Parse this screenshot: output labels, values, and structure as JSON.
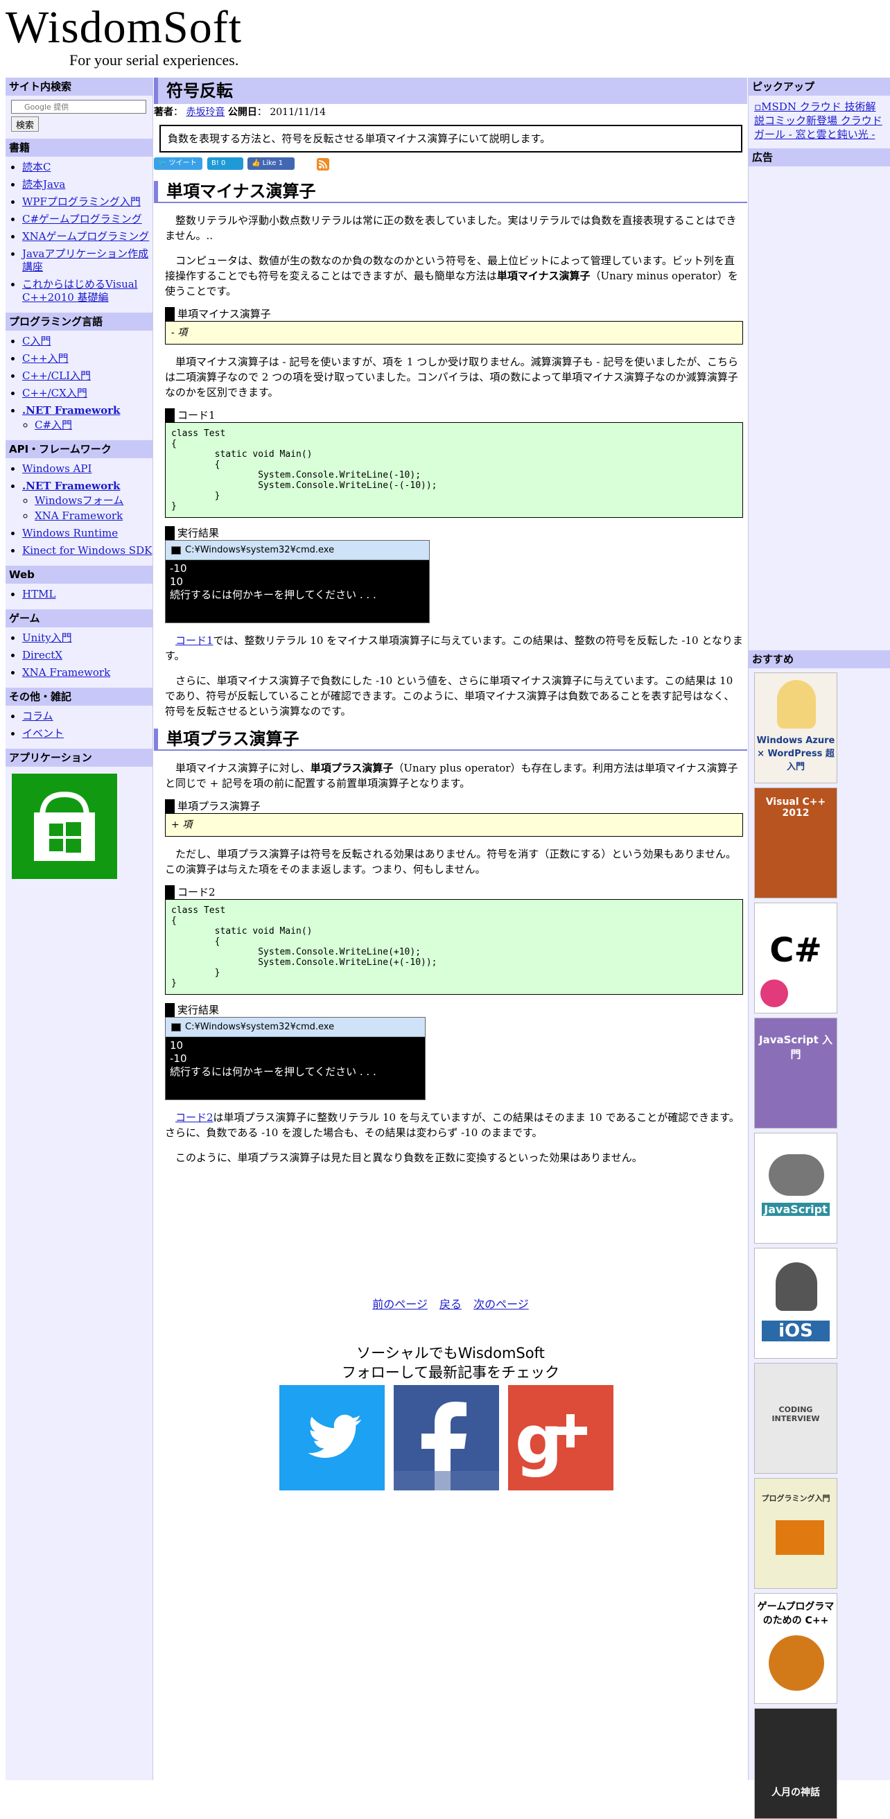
{
  "header": {
    "site_name": "WisdomSoft",
    "tagline": "For your serial experiences."
  },
  "left": {
    "search": {
      "heading": "サイト内検索",
      "placeholder": "Google 提供",
      "button": "検索"
    },
    "books": {
      "heading": "書籍",
      "items": [
        "読本C",
        "読本Java",
        "WPFプログラミング入門",
        "C#ゲームプログラミング",
        "XNAゲームプログラミング",
        "Javaアプリケーション作成講座",
        "これからはじめるVisual C++2010 基礎編"
      ]
    },
    "languages": {
      "heading": "プログラミング言語",
      "items": [
        "C入門",
        "C++入門",
        "C++/CLI入門",
        "C++/CX入門",
        ".NET Framework"
      ],
      "sub_items": [
        "C#入門"
      ]
    },
    "api": {
      "heading": "API・フレームワーク",
      "items": [
        "Windows API",
        ".NET Framework"
      ],
      "sub_items": [
        "Windowsフォーム",
        "XNA Framework"
      ],
      "items_after": [
        "Windows Runtime",
        "Kinect for Windows SDK"
      ]
    },
    "web": {
      "heading": "Web",
      "items": [
        "HTML"
      ]
    },
    "game": {
      "heading": "ゲーム",
      "items": [
        "Unity入門",
        "DirectX",
        "XNA Framework"
      ]
    },
    "misc": {
      "heading": "その他・雑記",
      "items": [
        "コラム",
        "イベント"
      ]
    },
    "apps": {
      "heading": "アプリケーション"
    }
  },
  "article": {
    "title": "符号反転",
    "author_label": "著者",
    "author": "赤坂玲音",
    "date_label": "公開日",
    "date": "2011/11/14",
    "summary": "負数を表現する方法と、符号を反転させる単項マイナス演算子にいて説明します。",
    "share": {
      "tweet": "ツイート",
      "hatena": "B! 0",
      "like": "Like 1"
    },
    "sec1": {
      "heading": "単項マイナス演算子",
      "p1": "整数リテラルや浮動小数点数リテラルは常に正の数を表していました。実はリテラルでは負数を直接表現することはできません。..",
      "p2_a": "コンピュータは、数値が生の数なのか負の数なのかという符号を、最上位ビットによって管理しています。ビット列を直接操作することでも符号を変えることはできますが、最も簡単な方法は",
      "p2_b": "単項マイナス演算子",
      "p2_c": "（Unary minus operator）を使うことです。",
      "syntax_label": "単項マイナス演算子",
      "syntax": "- 項",
      "p3": "単項マイナス演算子は - 記号を使いますが、項を 1 つしか受け取りません。減算演算子も - 記号を使いましたが、こちらは二項演算子なので 2 つの項を受け取っていました。コンパイラは、項の数によって単項マイナス演算子なのか減算演算子なのかを区別できます。",
      "code_label": "コード1",
      "code": "class Test\n{\n        static void Main()\n        {\n                System.Console.WriteLine(-10);\n                System.Console.WriteLine(-(-10));\n        }\n}",
      "result_label": "実行結果",
      "console_title": "C:¥Windows¥system32¥cmd.exe",
      "console_output": "-10\n10\n続行するには何かキーを押してください . . .",
      "p4_link": "コード1",
      "p4": "では、整数リテラル 10 をマイナス単項演算子に与えています。この結果は、整数の符号を反転した -10 となります。",
      "p5": "さらに、単項マイナス演算子で負数にした -10 という値を、さらに単項マイナス演算子に与えています。この結果は 10 であり、符号が反転していることが確認できます。このように、単項マイナス演算子は負数であることを表す記号はなく、符号を反転させるという演算なのです。"
    },
    "sec2": {
      "heading": "単項プラス演算子",
      "p1_a": "単項マイナス演算子に対し、",
      "p1_b": "単項プラス演算子",
      "p1_c": "（Unary plus operator）も存在します。利用方法は単項マイナス演算子と同じで + 記号を項の前に配置する前置単項演算子となります。",
      "syntax_label": "単項プラス演算子",
      "syntax": "+ 項",
      "p2": "ただし、単項プラス演算子は符号を反転される効果はありません。符号を消す（正数にする）という効果もありません。この演算子は与えた項をそのまま返します。つまり、何もしません。",
      "code_label": "コード2",
      "code": "class Test\n{\n        static void Main()\n        {\n                System.Console.WriteLine(+10);\n                System.Console.WriteLine(+(-10));\n        }\n}",
      "result_label": "実行結果",
      "console_title": "C:¥Windows¥system32¥cmd.exe",
      "console_output": "10\n-10\n続行するには何かキーを押してください . . .",
      "p3_link": "コード2",
      "p3": "は単項プラス演算子に整数リテラル 10 を与えていますが、この結果はそのまま 10 であることが確認できます。さらに、負数である -10 を渡した場合も、その結果は変わらず -10 のままです。",
      "p4": "このように、単項プラス演算子は見た目と異なり負数を正数に変換するといった効果はありません。"
    },
    "pager": {
      "prev": "前のページ",
      "back": "戻る",
      "next": "次のページ"
    },
    "social": {
      "line1": "ソーシャルでもWisdomSoft",
      "line2": "フォローして最新記事をチェック"
    }
  },
  "right": {
    "pickup_heading": "ピックアップ",
    "pickup_link": "MSDN クラウド 技術解説コミック新登場 クラウド ガール - 窓と雲と鈍い光 -",
    "ad_heading": "広告",
    "recommend_heading": "おすすめ",
    "book_titles": [
      "Windows Azure × WordPress 超入門",
      "Visual C++ 2012",
      "C#",
      "JavaScript 入門",
      "JavaScript",
      "iOS",
      "CODING INTERVIEW",
      "プログラミング入門",
      "ゲームプログラマのための C++",
      "人月の神話"
    ]
  },
  "colors": {
    "accent": "#8080e0",
    "head_bg": "#c8c8f8",
    "side_bg": "#eeeeff",
    "code_bg": "#d8ffd8",
    "syntax_bg": "#ffffd8",
    "link": "#1a1acc"
  }
}
